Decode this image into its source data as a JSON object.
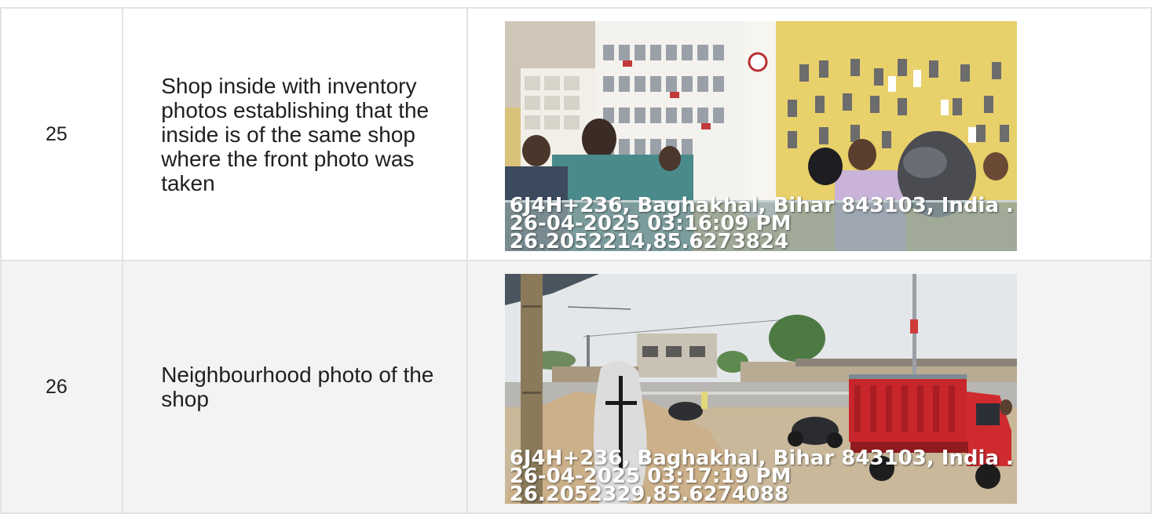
{
  "rows": [
    {
      "number": "25",
      "description": "Shop inside with inventory photos establishing that the inside is of the same shop where the front photo was taken",
      "photo": {
        "icon": "shop-interior-photo",
        "stamp": {
          "address": "6J4H+236, Baghakhal, Bihar 843103, India .",
          "datetime": "26-04-2025 03:16:09 PM",
          "coordinates": "26.2052214,85.6273824"
        }
      }
    },
    {
      "number": "26",
      "description": "Neighbourhood photo of the shop",
      "photo": {
        "icon": "neighbourhood-street-photo",
        "stamp": {
          "address": "6J4H+236, Baghakhal, Bihar 843103, India .",
          "datetime": "26-04-2025 03:17:19 PM",
          "coordinates": "26.2052329,85.6274088"
        }
      }
    }
  ],
  "colors": {
    "border": "#e2e2e2",
    "alt_row": "#f3f3f3",
    "shop_wall": "#e8d06a",
    "sky": "#e4e7e9",
    "ground": "#c9b89a",
    "truck": "#c8262a"
  }
}
